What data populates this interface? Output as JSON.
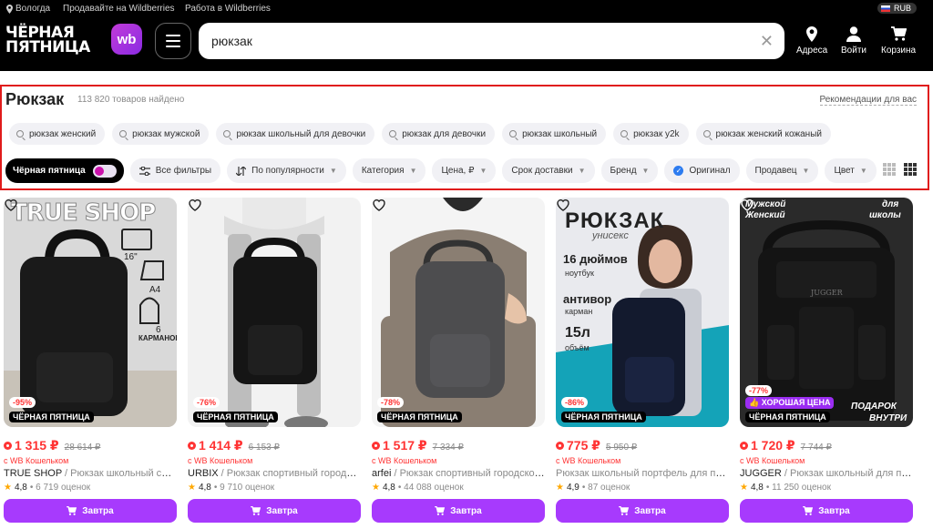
{
  "topbar": {
    "location": "Вологда",
    "sell": "Продавайте на Wildberries",
    "work": "Работа в Wildberries",
    "currency": "RUB"
  },
  "logo": {
    "line1": "ЧЁРНАЯ",
    "line2": "ПЯТНИЦА",
    "wb": "wb"
  },
  "search": {
    "value": "рюкзак"
  },
  "nav": {
    "addresses": "Адреса",
    "login": "Войти",
    "cart": "Корзина"
  },
  "catalog": {
    "title": "Рюкзак",
    "count": "113 820 товаров найдено",
    "recommendations": "Рекомендации для вас",
    "suggestions": [
      "рюкзак женский",
      "рюкзак мужской",
      "рюкзак школьный для девочки",
      "рюкзак для девочки",
      "рюкзак школьный",
      "рюкзак y2k",
      "рюкзак женский кожаный"
    ],
    "black_friday_toggle": "Чёрная пятница",
    "filters": {
      "all": "Все фильтры",
      "sort": "По популярности",
      "category": "Категория",
      "price": "Цена, ₽",
      "delivery": "Срок доставки",
      "brand": "Бренд",
      "original": "Оригинал",
      "seller": "Продавец",
      "color": "Цвет"
    }
  },
  "products": [
    {
      "discount": "-95%",
      "badge": "ЧЁРНАЯ ПЯТНИЦА",
      "price": "1 315 ₽",
      "old_price": "28 614 ₽",
      "wallet": "с WB Кошельком",
      "brand": "TRUE SHOP",
      "desc": " / Рюкзак школьный спортив...",
      "rating": "4,8",
      "reviews": "• 6 719 оценок",
      "buy": "Завтра",
      "img_text": [
        "TRUE SHOP",
        "16\"",
        "A4",
        "6",
        "КАРМАНОВ"
      ]
    },
    {
      "discount": "-76%",
      "badge": "ЧЁРНАЯ ПЯТНИЦА",
      "price": "1 414 ₽",
      "old_price": "6 153 ₽",
      "wallet": "с WB Кошельком",
      "brand": "URBIX",
      "desc": " / Рюкзак спортивный городской",
      "rating": "4,8",
      "reviews": "• 9 710 оценок",
      "buy": "Завтра"
    },
    {
      "discount": "-78%",
      "badge": "ЧЁРНАЯ ПЯТНИЦА",
      "price": "1 517 ₽",
      "old_price": "7 334 ₽",
      "wallet": "с WB Кошельком",
      "brand": "arfei",
      "desc": " / Рюкзак спортивный городской для ...",
      "rating": "4,8",
      "reviews": "• 44 088 оценок",
      "buy": "Завтра"
    },
    {
      "discount": "-86%",
      "badge": "ЧЁРНАЯ ПЯТНИЦА",
      "price": "775 ₽",
      "old_price": "5 950 ₽",
      "wallet": "с WB Кошельком",
      "brand": "",
      "desc": "Рюкзак школьный портфель для подрос...",
      "rating": "4,9",
      "reviews": "• 87 оценок",
      "buy": "Завтра",
      "img_text": [
        "РЮКЗАК",
        "унисекс",
        "16 дюймов",
        "ноутбук",
        "антивор",
        "карман",
        "15л",
        "объём"
      ]
    },
    {
      "discount": "-77%",
      "good_price": "ХОРОШАЯ ЦЕНА",
      "badge": "ЧЁРНАЯ ПЯТНИЦА",
      "price": "1 720 ₽",
      "old_price": "7 744 ₽",
      "wallet": "с WB Кошельком",
      "brand": "JUGGER",
      "desc": " / Рюкзак школьный для подрост...",
      "rating": "4,8",
      "reviews": "• 11 250 оценок",
      "buy": "Завтра",
      "img_text": [
        "Мужской",
        "Женский",
        "для",
        "школы",
        "JUGGER",
        "ПОДАРОК",
        "ВНУТРИ"
      ]
    }
  ],
  "colors": {
    "accent": "#a73afd",
    "price": "#ff3333",
    "highlight_border": "#e01b1b"
  }
}
